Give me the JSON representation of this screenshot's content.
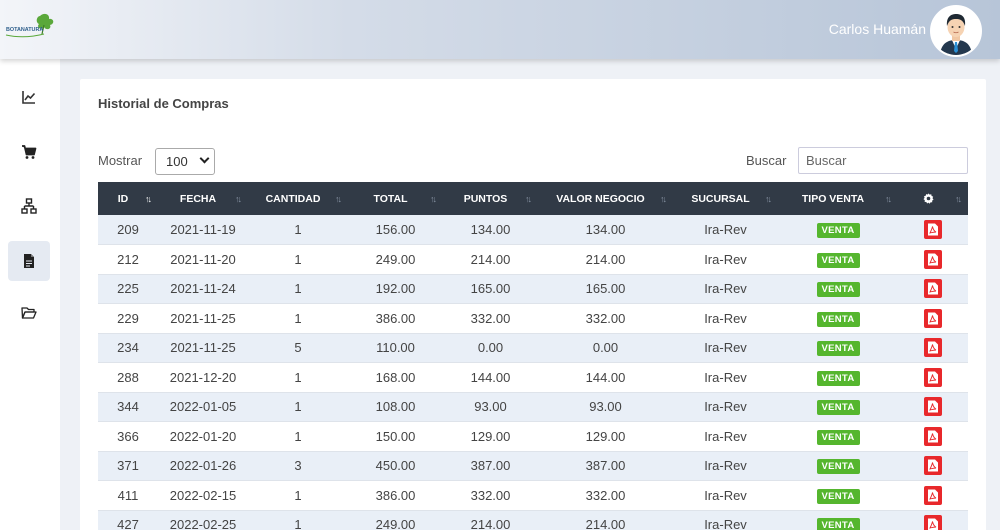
{
  "header": {
    "logo_text": "BOTANATURA",
    "user_name": "Carlos Huamán"
  },
  "sidebar": {
    "items": [
      {
        "name": "chart-line-icon",
        "active": false
      },
      {
        "name": "cart-icon",
        "active": false
      },
      {
        "name": "network-icon",
        "active": false
      },
      {
        "name": "document-icon",
        "active": true
      },
      {
        "name": "folder-open-icon",
        "active": false
      }
    ]
  },
  "main": {
    "title": "Historial de Compras",
    "show_label": "Mostrar",
    "show_value": "100",
    "search_label": "Buscar",
    "search_placeholder": "Buscar",
    "columns": [
      "ID",
      "FECHA",
      "CANTIDAD",
      "TOTAL",
      "PUNTOS",
      "VALOR NEGOCIO",
      "SUCURSAL",
      "TIPO VENTA"
    ],
    "settings_icon": "gear-icon",
    "rows": [
      {
        "id": "209",
        "fecha": "2021-11-19",
        "cantidad": "1",
        "total": "156.00",
        "puntos": "134.00",
        "valor": "134.00",
        "sucursal": "Ira-Rev",
        "tipo": "VENTA"
      },
      {
        "id": "212",
        "fecha": "2021-11-20",
        "cantidad": "1",
        "total": "249.00",
        "puntos": "214.00",
        "valor": "214.00",
        "sucursal": "Ira-Rev",
        "tipo": "VENTA"
      },
      {
        "id": "225",
        "fecha": "2021-11-24",
        "cantidad": "1",
        "total": "192.00",
        "puntos": "165.00",
        "valor": "165.00",
        "sucursal": "Ira-Rev",
        "tipo": "VENTA"
      },
      {
        "id": "229",
        "fecha": "2021-11-25",
        "cantidad": "1",
        "total": "386.00",
        "puntos": "332.00",
        "valor": "332.00",
        "sucursal": "Ira-Rev",
        "tipo": "VENTA"
      },
      {
        "id": "234",
        "fecha": "2021-11-25",
        "cantidad": "5",
        "total": "110.00",
        "puntos": "0.00",
        "valor": "0.00",
        "sucursal": "Ira-Rev",
        "tipo": "VENTA"
      },
      {
        "id": "288",
        "fecha": "2021-12-20",
        "cantidad": "1",
        "total": "168.00",
        "puntos": "144.00",
        "valor": "144.00",
        "sucursal": "Ira-Rev",
        "tipo": "VENTA"
      },
      {
        "id": "344",
        "fecha": "2022-01-05",
        "cantidad": "1",
        "total": "108.00",
        "puntos": "93.00",
        "valor": "93.00",
        "sucursal": "Ira-Rev",
        "tipo": "VENTA"
      },
      {
        "id": "366",
        "fecha": "2022-01-20",
        "cantidad": "1",
        "total": "150.00",
        "puntos": "129.00",
        "valor": "129.00",
        "sucursal": "Ira-Rev",
        "tipo": "VENTA"
      },
      {
        "id": "371",
        "fecha": "2022-01-26",
        "cantidad": "3",
        "total": "450.00",
        "puntos": "387.00",
        "valor": "387.00",
        "sucursal": "Ira-Rev",
        "tipo": "VENTA"
      },
      {
        "id": "411",
        "fecha": "2022-02-15",
        "cantidad": "1",
        "total": "386.00",
        "puntos": "332.00",
        "valor": "332.00",
        "sucursal": "Ira-Rev",
        "tipo": "VENTA"
      },
      {
        "id": "427",
        "fecha": "2022-02-25",
        "cantidad": "1",
        "total": "249.00",
        "puntos": "214.00",
        "valor": "214.00",
        "sucursal": "Ira-Rev",
        "tipo": "VENTA"
      }
    ]
  },
  "colors": {
    "table_header": "#313a46",
    "badge_green": "#55b62e",
    "pdf_red": "#e8282b",
    "row_stripe": "#e9eff7"
  }
}
